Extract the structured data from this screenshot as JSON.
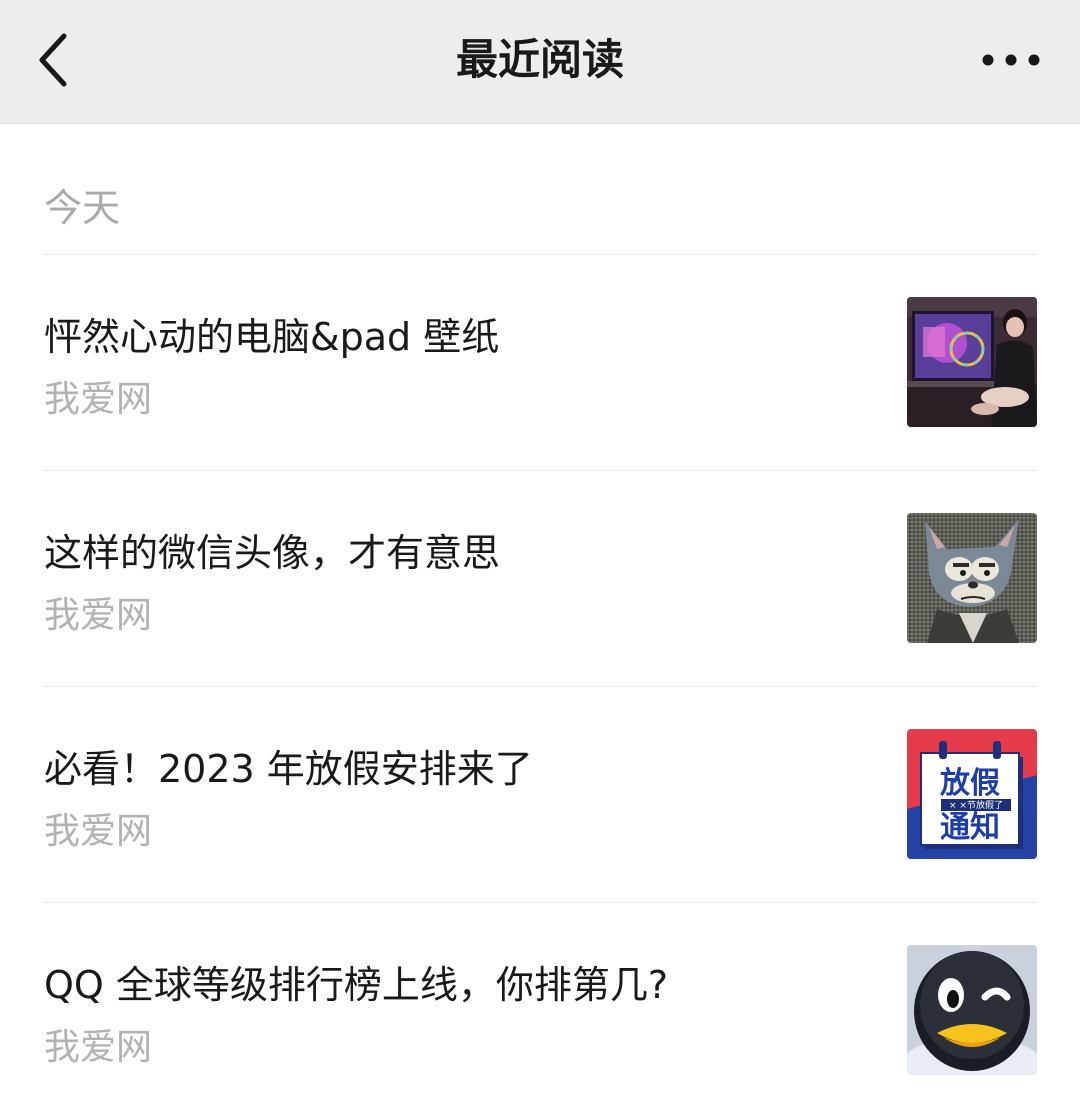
{
  "navbar": {
    "title": "最近阅读",
    "back_icon": "chevron-left-icon",
    "more_icon": "more-dots-icon"
  },
  "section": {
    "label": "今天"
  },
  "articles": [
    {
      "title": "怦然心动的电脑&pad 壁纸",
      "source": "我爱网",
      "thumb": "wallpaper-desk-photo"
    },
    {
      "title": "这样的微信头像，才有意思",
      "source": "我爱网",
      "thumb": "cartoon-cat-mosaic"
    },
    {
      "title": "必看！2023 年放假安排来了",
      "source": "我爱网",
      "thumb": "holiday-notice-calendar",
      "thumb_text": {
        "line1": "放假",
        "small": "× ×节放假了",
        "line2": "通知"
      }
    },
    {
      "title": "QQ 全球等级排行榜上线，你排第几?",
      "source": "我爱网",
      "thumb": "qq-penguin-face"
    }
  ],
  "colors": {
    "navbar_bg": "#ededed",
    "title_text": "#191919",
    "secondary_text": "#b2b2b2",
    "divider": "#e6e6e6"
  }
}
